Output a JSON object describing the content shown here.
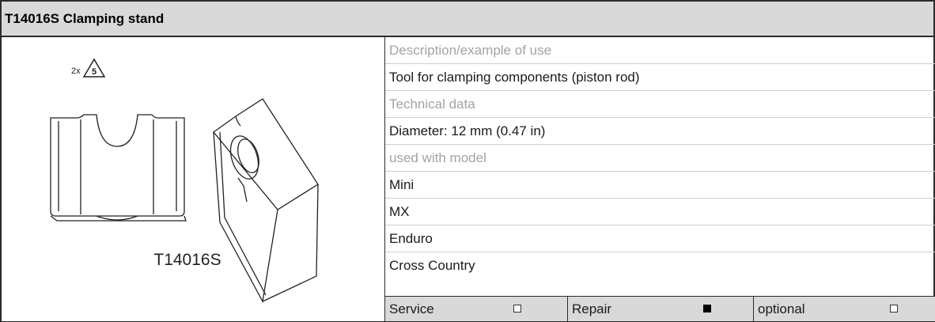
{
  "header": {
    "title": "T14016S Clamping stand"
  },
  "figure": {
    "caption": "T14016S",
    "quantity": "2x",
    "badge": "5"
  },
  "details": [
    {
      "kind": "label",
      "text": "Description/example of use"
    },
    {
      "kind": "value",
      "text": "Tool for clamping components (piston rod)"
    },
    {
      "kind": "label",
      "text": "Technical data"
    },
    {
      "kind": "value",
      "text": "Diameter: 12 mm (0.47 in)"
    },
    {
      "kind": "label",
      "text": "used with model"
    },
    {
      "kind": "value",
      "text": "Mini"
    },
    {
      "kind": "value",
      "text": "MX"
    },
    {
      "kind": "value",
      "text": "Enduro"
    },
    {
      "kind": "value",
      "text": "Cross Country"
    }
  ],
  "options": [
    {
      "label": "Service",
      "checked": false
    },
    {
      "label": "Repair",
      "checked": true
    },
    {
      "label": "optional",
      "checked": false
    }
  ]
}
